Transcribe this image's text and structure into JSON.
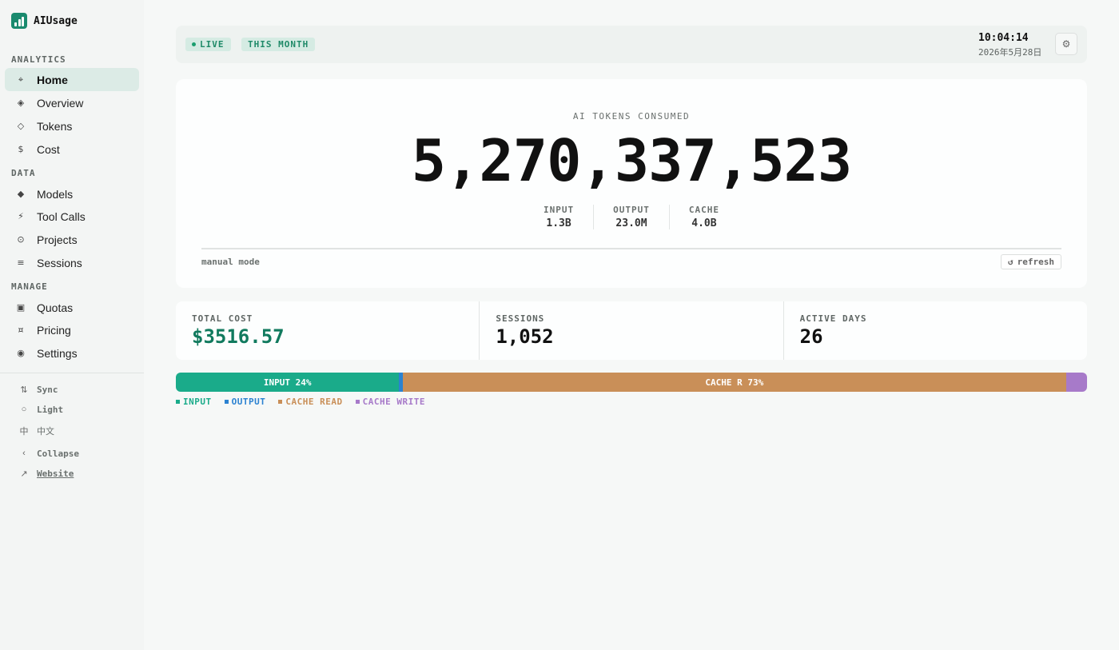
{
  "brand": {
    "name": "AIUsage",
    "logo_icon": "bar-chart-logo"
  },
  "sidebar": {
    "sections": [
      {
        "label": "ANALYTICS"
      },
      {
        "label": "DATA"
      },
      {
        "label": "MANAGE"
      }
    ],
    "items": [
      {
        "label": "Home",
        "icon": "⌖",
        "active": true
      },
      {
        "label": "Overview",
        "icon": "◈"
      },
      {
        "label": "Tokens",
        "icon": "◇"
      },
      {
        "label": "Cost",
        "icon": "$"
      },
      {
        "label": "Models",
        "icon": "◆"
      },
      {
        "label": "Tool Calls",
        "icon": "⚡"
      },
      {
        "label": "Projects",
        "icon": "⊙"
      },
      {
        "label": "Sessions",
        "icon": "≡"
      },
      {
        "label": "Quotas",
        "icon": "▣"
      },
      {
        "label": "Pricing",
        "icon": "¤"
      },
      {
        "label": "Settings",
        "icon": "◉"
      }
    ],
    "utilities": [
      {
        "label": "Sync",
        "icon": "⇅"
      },
      {
        "label": "Light",
        "icon": "○"
      },
      {
        "label": "中文",
        "icon": "中"
      },
      {
        "label": "Collapse",
        "icon": "‹"
      },
      {
        "label": "Website",
        "icon": "↗"
      }
    ]
  },
  "topbar": {
    "live_label": "LIVE",
    "period_label": "THIS MONTH",
    "time": "10:04:14",
    "date": "2026年5月28日",
    "settings_icon": "⚙"
  },
  "hero": {
    "label": "AI TOKENS CONSUMED",
    "total": "5,270,337,523",
    "breakdown": [
      {
        "label": "INPUT",
        "value": "1.3B"
      },
      {
        "label": "OUTPUT",
        "value": "23.0M"
      },
      {
        "label": "CACHE",
        "value": "4.0B"
      }
    ],
    "mode": "manual mode",
    "refresh_label": "refresh",
    "refresh_icon": "↺"
  },
  "stats": [
    {
      "label": "TOTAL COST",
      "value": "$3516.57"
    },
    {
      "label": "SESSIONS",
      "value": "1,052"
    },
    {
      "label": "ACTIVE DAYS",
      "value": "26"
    }
  ],
  "composition": {
    "segments": [
      {
        "name": "INPUT",
        "bar_label": "INPUT 24%",
        "fraction": 0.245,
        "color": "#1aab8a"
      },
      {
        "name": "OUTPUT",
        "bar_label": "",
        "fraction": 0.004,
        "color": "#2b82d1"
      },
      {
        "name": "CACHE READ",
        "bar_label": "CACHE R 73%",
        "fraction": 0.728,
        "color": "#c98f58"
      },
      {
        "name": "CACHE WRITE",
        "bar_label": "",
        "fraction": 0.023,
        "color": "#a77ac9"
      }
    ],
    "legend_colors": [
      "#1aab8a",
      "#2b82d1",
      "#c98f58",
      "#a77ac9"
    ]
  }
}
